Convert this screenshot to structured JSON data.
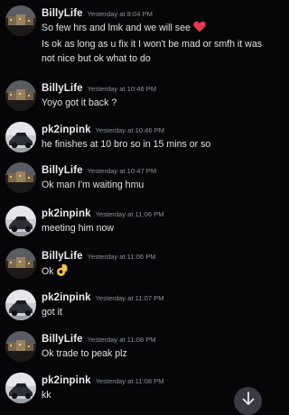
{
  "colors": {
    "background": "#060608",
    "author": "#ececef",
    "timestamp": "#8e909a",
    "text": "#e0e1e5",
    "heart": "#e8384f",
    "ok_hand": "#f5c242",
    "scroll_button": "#3a3b42"
  },
  "messages": [
    {
      "author": "BillyLife",
      "timestamp": "Yesterday at 8:04 PM",
      "lines": [
        "So few hrs and lmk and we will see",
        "Is ok as long as u fix it I won't be mad or smfh it was not nice but ok what to do"
      ],
      "emoji": "heart-icon"
    },
    {
      "author": "BillyLife",
      "timestamp": "Yesterday at 10:46 PM",
      "lines": [
        "Yoyo got it back ?"
      ]
    },
    {
      "author": "pk2inpink",
      "timestamp": "Yesterday at 10:46 PM",
      "lines": [
        "he finishes at 10 bro so in 15 mins or so"
      ]
    },
    {
      "author": "BillyLife",
      "timestamp": "Yesterday at 10:47 PM",
      "lines": [
        "Ok man I'm waiting hmu"
      ]
    },
    {
      "author": "pk2inpink",
      "timestamp": "Yesterday at 11:06 PM",
      "lines": [
        "meeting him now"
      ]
    },
    {
      "author": "BillyLife",
      "timestamp": "Yesterday at 11:06 PM",
      "lines": [
        "Ok"
      ],
      "emoji": "ok-hand-icon"
    },
    {
      "author": "pk2inpink",
      "timestamp": "Yesterday at 11:07 PM",
      "lines": [
        "got it"
      ]
    },
    {
      "author": "BillyLife",
      "timestamp": "Yesterday at 11:08 PM",
      "lines": [
        "Ok trade to peak plz"
      ]
    },
    {
      "author": "pk2inpink",
      "timestamp": "Yesterday at 11:08 PM",
      "lines": [
        "kk"
      ]
    }
  ],
  "scroll_button": {
    "icon": "arrow-down-icon"
  }
}
